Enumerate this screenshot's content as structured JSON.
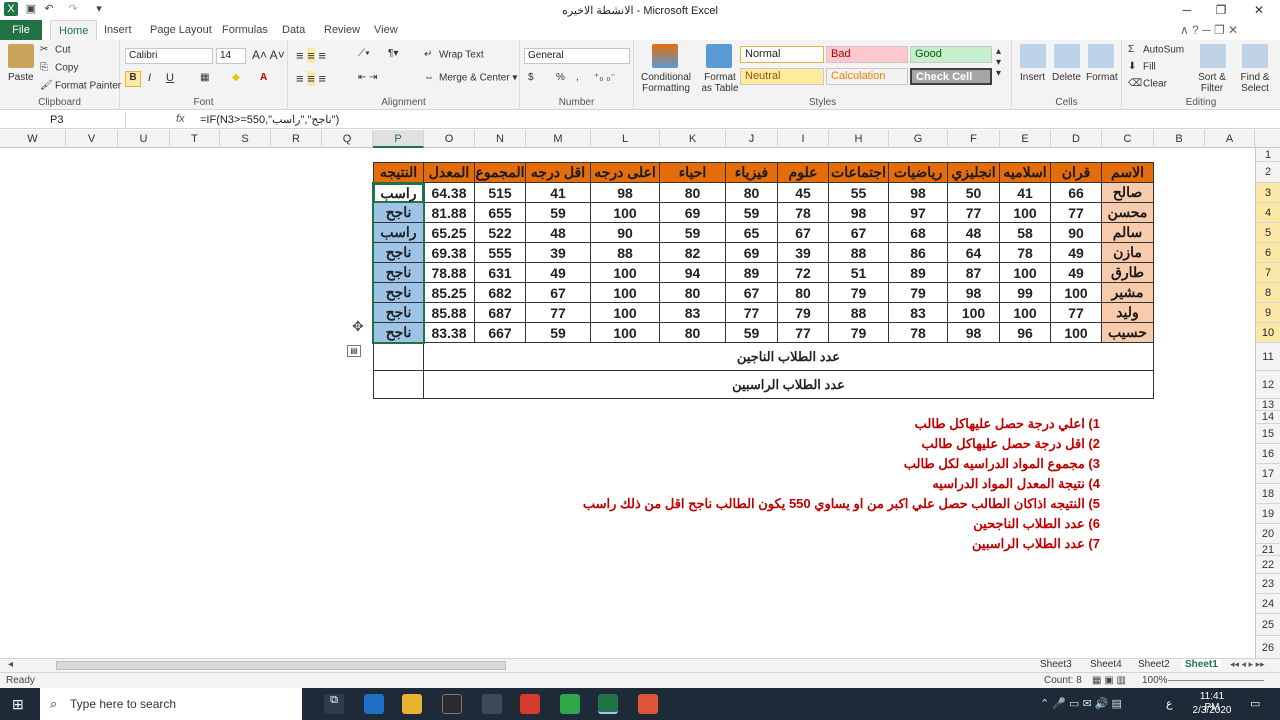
{
  "window": {
    "title": "الانشطة الاخيره - Microsoft Excel"
  },
  "tabs": [
    "File",
    "Home",
    "Insert",
    "Page Layout",
    "Formulas",
    "Data",
    "Review",
    "View"
  ],
  "ribbon": {
    "clipboard": {
      "paste": "Paste",
      "cut": "Cut",
      "copy": "Copy",
      "format_painter": "Format Painter",
      "label": "Clipboard"
    },
    "font": {
      "name": "Calibri",
      "size": "14",
      "bold": "B",
      "italic": "I",
      "underline": "U",
      "label": "Font"
    },
    "alignment": {
      "wrap": "Wrap Text",
      "merge": "Merge & Center",
      "label": "Alignment"
    },
    "number": {
      "format": "General",
      "currency": "$",
      "percent": "%",
      "comma": ",",
      "label": "Number"
    },
    "styles": {
      "cond": "Conditional Formatting",
      "table": "Format as Table",
      "normal": "Normal",
      "bad": "Bad",
      "good": "Good",
      "neutral": "Neutral",
      "calculation": "Calculation",
      "check": "Check Cell",
      "label": "Styles"
    },
    "cells": {
      "insert": "Insert",
      "delete": "Delete",
      "format": "Format",
      "label": "Cells"
    },
    "editing": {
      "autosum": "AutoSum",
      "fill": "Fill",
      "clear": "Clear",
      "sort": "Sort & Filter",
      "find": "Find & Select",
      "label": "Editing"
    }
  },
  "formula_bar": {
    "name_box": "P3",
    "fx": "fx",
    "formula": "=IF(N3>=550,\"ناجح\",\"راسب\")"
  },
  "columns": [
    "W",
    "V",
    "U",
    "T",
    "S",
    "R",
    "Q",
    "P",
    "O",
    "N",
    "M",
    "L",
    "K",
    "J",
    "I",
    "H",
    "G",
    "F",
    "E",
    "D",
    "C",
    "B",
    "A"
  ],
  "rows": [
    "1",
    "2",
    "3",
    "4",
    "5",
    "6",
    "7",
    "8",
    "9",
    "10",
    "11",
    "12",
    "13",
    "14",
    "15",
    "16",
    "17",
    "18",
    "19",
    "20",
    "21",
    "22",
    "23",
    "24",
    "25",
    "26"
  ],
  "table": {
    "headers": [
      "النتيجه",
      "المعدل",
      "المجموع",
      "اقل درجه",
      "اعلى درجه",
      "احياء",
      "فيزياء",
      "علوم",
      "اجتماعات",
      "رياضيات",
      "انجليزي",
      "اسلاميه",
      "قران",
      "الاسم"
    ],
    "rows": [
      [
        "راسب",
        "64.38",
        "515",
        "41",
        "98",
        "80",
        "80",
        "45",
        "55",
        "98",
        "50",
        "41",
        "66",
        "صالح"
      ],
      [
        "ناجح",
        "81.88",
        "655",
        "59",
        "100",
        "69",
        "59",
        "78",
        "98",
        "97",
        "77",
        "100",
        "77",
        "محسن"
      ],
      [
        "راسب",
        "65.25",
        "522",
        "48",
        "90",
        "59",
        "65",
        "67",
        "67",
        "68",
        "48",
        "58",
        "90",
        "سالم"
      ],
      [
        "ناجح",
        "69.38",
        "555",
        "39",
        "88",
        "82",
        "69",
        "39",
        "88",
        "86",
        "64",
        "78",
        "49",
        "مازن"
      ],
      [
        "ناجح",
        "78.88",
        "631",
        "49",
        "100",
        "94",
        "89",
        "72",
        "51",
        "89",
        "87",
        "100",
        "49",
        "طارق"
      ],
      [
        "ناجح",
        "85.25",
        "682",
        "67",
        "100",
        "80",
        "67",
        "80",
        "79",
        "79",
        "98",
        "99",
        "100",
        "مشير"
      ],
      [
        "ناجح",
        "85.88",
        "687",
        "77",
        "100",
        "83",
        "77",
        "79",
        "88",
        "83",
        "100",
        "100",
        "77",
        "وليد"
      ],
      [
        "ناجح",
        "83.38",
        "667",
        "59",
        "100",
        "80",
        "59",
        "77",
        "79",
        "78",
        "98",
        "96",
        "100",
        "حسيب"
      ]
    ],
    "count_pass_label": "عدد الطلاب الناجين",
    "count_fail_label": "عدد الطلاب الراسبين"
  },
  "notes": [
    "1) اعلي درجة حصل عليهاكل طالب",
    "2) اقل درجة حصل عليهاكل طالب",
    "3) مجموع المواد الدراسيه لكل طالب",
    "4) نتيجة المعدل المواد الدراسيه",
    "5) النتيجه اذاكان الطالب حصل علي اكبر من او يساوي 550 يكون الطالب ناجح اقل من ذلك راسب",
    "6) عدد الطلاب الناجحين",
    "7) عدد الطلاب الراسبين"
  ],
  "sheets": [
    "Sheet3",
    "Sheet4",
    "Sheet2",
    "Sheet1"
  ],
  "status": {
    "ready": "Ready",
    "count": "Count: 8",
    "zoom": "100%"
  },
  "taskbar": {
    "search": "Type here to search",
    "time": "11:41 PM",
    "date": "2/3/2020",
    "lang": "ع"
  },
  "colors": {
    "excel_green": "#217346",
    "header_orange": "#e46c0a",
    "name_peach": "#f8cbad",
    "result_blue": "#9dc3e6",
    "note_red": "#c00000"
  }
}
